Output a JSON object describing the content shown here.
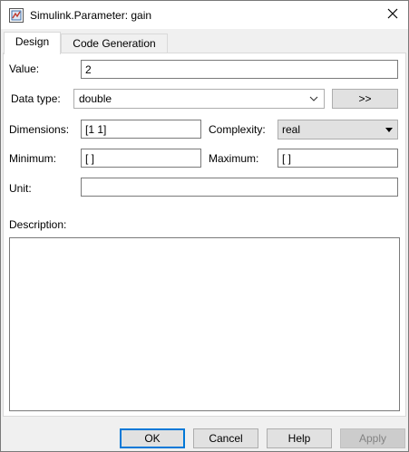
{
  "window": {
    "title": "Simulink.Parameter: gain"
  },
  "tabs": [
    {
      "label": "Design",
      "active": true
    },
    {
      "label": "Code Generation",
      "active": false
    }
  ],
  "form": {
    "value_label": "Value:",
    "value": "2",
    "data_type_label": "Data type:",
    "data_type_value": "double",
    "data_type_assist_button": ">>",
    "dimensions_label": "Dimensions:",
    "dimensions_value": "[1 1]",
    "complexity_label": "Complexity:",
    "complexity_value": "real",
    "minimum_label": "Minimum:",
    "minimum_value": "[ ]",
    "maximum_label": "Maximum:",
    "maximum_value": "[ ]",
    "unit_label": "Unit:",
    "unit_value": "",
    "description_label": "Description:",
    "description_value": ""
  },
  "footer": {
    "ok": "OK",
    "cancel": "Cancel",
    "help": "Help",
    "apply": "Apply"
  },
  "icons": {
    "app": "simulink-app-icon",
    "close": "close-icon",
    "dropdown": "chevron-down-icon"
  }
}
